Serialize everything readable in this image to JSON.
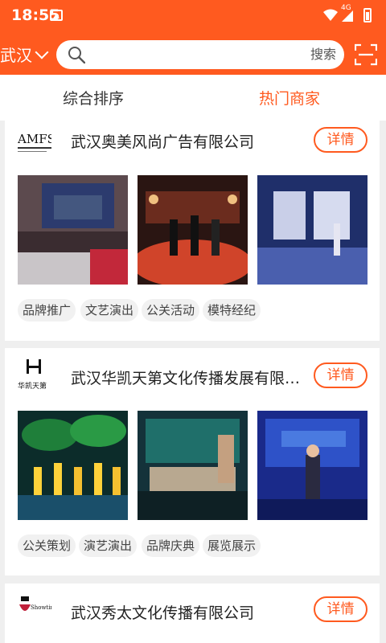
{
  "status_bar": {
    "time": "18:55",
    "network": "4G"
  },
  "header": {
    "city": "武汉",
    "search_placeholder": "",
    "search_button": "搜索"
  },
  "tabs": [
    {
      "label": "综合排序",
      "active": false
    },
    {
      "label": "热门商家",
      "active": true
    }
  ],
  "colors": {
    "brand": "#ff5a1f"
  },
  "businesses": [
    {
      "logo_text": "AMFS",
      "name": "武汉奥美风尚广告有限公司",
      "detail_label": "详情",
      "tags": [
        "品牌推广",
        "文艺演出",
        "公关活动",
        "模特经纪"
      ]
    },
    {
      "logo_text": "华凯天第",
      "name": "武汉华凯天第文化传播发展有限公司",
      "detail_label": "详情",
      "tags": [
        "公关策划",
        "演艺演出",
        "品牌庆典",
        "展览展示"
      ]
    },
    {
      "logo_text": "Showtime",
      "name": "武汉秀太文化传播有限公司",
      "detail_label": "详情",
      "tags": []
    }
  ]
}
